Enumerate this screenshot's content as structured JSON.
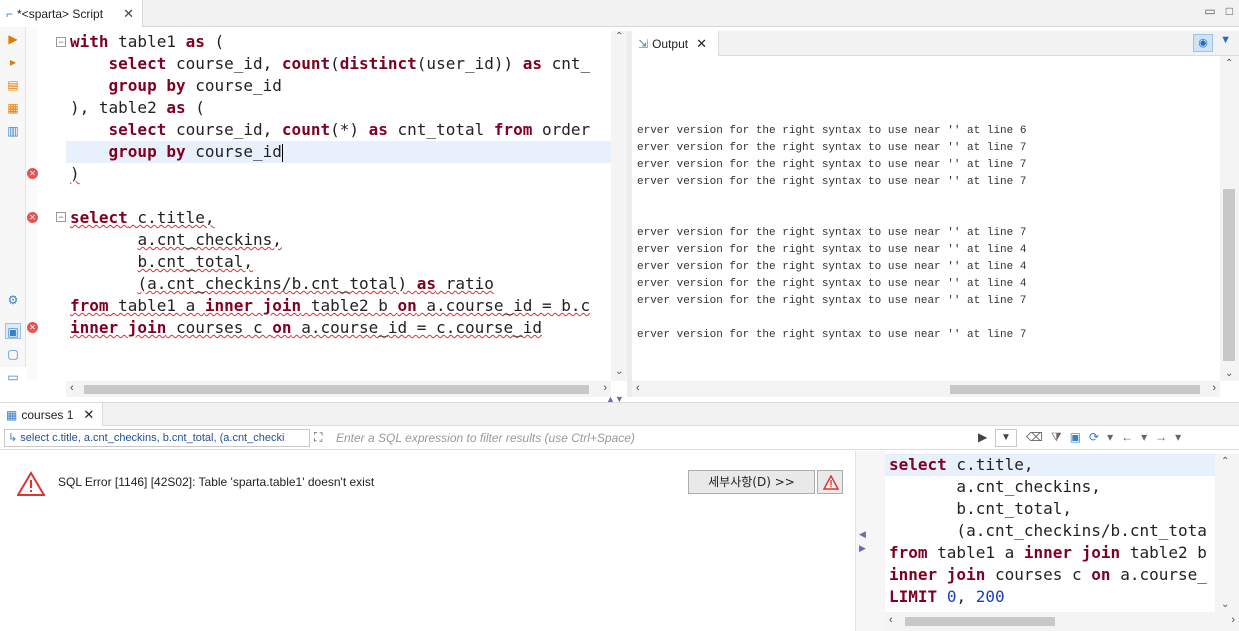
{
  "editor_tab": {
    "title": "*<sparta> Script",
    "close": "✕"
  },
  "window_buttons": {
    "minimize": "▭",
    "maximize": "□"
  },
  "editor_lines": [
    {
      "parts": [
        {
          "t": "with",
          "k": 1,
          "s": 0
        },
        {
          "t": " table1 ",
          "k": 0,
          "s": 0
        },
        {
          "t": "as",
          "k": 1,
          "s": 0
        },
        {
          "t": " (",
          "k": 0,
          "s": 0
        }
      ]
    },
    {
      "parts": [
        {
          "t": "    ",
          "k": 0,
          "s": 0
        },
        {
          "t": "select",
          "k": 1,
          "s": 0
        },
        {
          "t": " course_id, ",
          "k": 0,
          "s": 0
        },
        {
          "t": "count",
          "k": 1,
          "s": 0
        },
        {
          "t": "(",
          "k": 0,
          "s": 0
        },
        {
          "t": "distinct",
          "k": 1,
          "s": 0
        },
        {
          "t": "(user_id)) ",
          "k": 0,
          "s": 0
        },
        {
          "t": "as",
          "k": 1,
          "s": 0
        },
        {
          "t": " cnt_",
          "k": 0,
          "s": 0
        }
      ]
    },
    {
      "parts": [
        {
          "t": "    ",
          "k": 0,
          "s": 0
        },
        {
          "t": "group by",
          "k": 1,
          "s": 0
        },
        {
          "t": " course_id",
          "k": 0,
          "s": 0
        }
      ]
    },
    {
      "parts": [
        {
          "t": "), table2 ",
          "k": 0,
          "s": 0
        },
        {
          "t": "as",
          "k": 1,
          "s": 0
        },
        {
          "t": " (",
          "k": 0,
          "s": 0
        }
      ]
    },
    {
      "parts": [
        {
          "t": "    ",
          "k": 0,
          "s": 0
        },
        {
          "t": "select",
          "k": 1,
          "s": 0
        },
        {
          "t": " course_id, ",
          "k": 0,
          "s": 0
        },
        {
          "t": "count",
          "k": 1,
          "s": 0
        },
        {
          "t": "(*) ",
          "k": 0,
          "s": 0
        },
        {
          "t": "as",
          "k": 1,
          "s": 0
        },
        {
          "t": " cnt_total ",
          "k": 0,
          "s": 0
        },
        {
          "t": "from",
          "k": 1,
          "s": 0
        },
        {
          "t": " order",
          "k": 0,
          "s": 0
        }
      ]
    },
    {
      "parts": [
        {
          "t": "    ",
          "k": 0,
          "s": 0
        },
        {
          "t": "group by",
          "k": 1,
          "s": 0
        },
        {
          "t": " course_id",
          "k": 0,
          "s": 0
        }
      ]
    },
    {
      "parts": [
        {
          "t": ")",
          "k": 0,
          "s": 1
        }
      ]
    },
    {
      "parts": []
    },
    {
      "parts": [
        {
          "t": "select",
          "k": 1,
          "s": 1
        },
        {
          "t": " c.title,",
          "k": 0,
          "s": 1
        }
      ]
    },
    {
      "parts": [
        {
          "t": "       ",
          "k": 0,
          "s": 0
        },
        {
          "t": "a.cnt_checkins,",
          "k": 0,
          "s": 1
        }
      ]
    },
    {
      "parts": [
        {
          "t": "       ",
          "k": 0,
          "s": 0
        },
        {
          "t": "b.cnt_total,",
          "k": 0,
          "s": 1
        }
      ]
    },
    {
      "parts": [
        {
          "t": "       ",
          "k": 0,
          "s": 0
        },
        {
          "t": "(a.cnt_checkins/b.cnt_total) ",
          "k": 0,
          "s": 1
        },
        {
          "t": "as",
          "k": 1,
          "s": 1
        },
        {
          "t": " ratio",
          "k": 0,
          "s": 1
        }
      ]
    },
    {
      "parts": [
        {
          "t": "from",
          "k": 1,
          "s": 1
        },
        {
          "t": " table1 a ",
          "k": 0,
          "s": 1
        },
        {
          "t": "inner join",
          "k": 1,
          "s": 1
        },
        {
          "t": " table2 b ",
          "k": 0,
          "s": 1
        },
        {
          "t": "on",
          "k": 1,
          "s": 1
        },
        {
          "t": " a.course_id = b.c",
          "k": 0,
          "s": 1
        }
      ]
    },
    {
      "parts": [
        {
          "t": "inner join",
          "k": 1,
          "s": 1
        },
        {
          "t": " courses c ",
          "k": 0,
          "s": 1
        },
        {
          "t": "on",
          "k": 1,
          "s": 1
        },
        {
          "t": " a.course_id = c.course_id",
          "k": 0,
          "s": 1
        }
      ]
    }
  ],
  "output_tab": {
    "title": "Output",
    "close": "✕"
  },
  "output_lines": [
    {
      "row": 4,
      "text": "erver version for the right syntax to use near '' at line 6"
    },
    {
      "row": 5,
      "text": "erver version for the right syntax to use near '' at line 7"
    },
    {
      "row": 6,
      "text": "erver version for the right syntax to use near '' at line 7"
    },
    {
      "row": 7,
      "text": "erver version for the right syntax to use near '' at line 7"
    },
    {
      "row": 10,
      "text": "erver version for the right syntax to use near '' at line 7"
    },
    {
      "row": 11,
      "text": "erver version for the right syntax to use near '' at line 4"
    },
    {
      "row": 12,
      "text": "erver version for the right syntax to use near '' at line 4"
    },
    {
      "row": 13,
      "text": "erver version for the right syntax to use near '' at line 4"
    },
    {
      "row": 14,
      "text": "erver version for the right syntax to use near '' at line 7"
    },
    {
      "row": 16,
      "text": "erver version for the right syntax to use near '' at line 7"
    }
  ],
  "results_tab": {
    "title": "courses 1",
    "close": "✕"
  },
  "filter": {
    "query_text": "select c.title, a.cnt_checkins, b.cnt_total, (a.cnt_checki",
    "placeholder": "Enter a SQL expression to filter results (use Ctrl+Space)"
  },
  "error": {
    "message": "SQL Error [1146] [42S02]: Table 'sparta.table1' doesn't exist",
    "details_button": "세부사항(D) >>"
  },
  "sql_preview": [
    {
      "parts": [
        {
          "t": "select",
          "k": 1
        },
        {
          "t": " c.title,",
          "k": 0
        }
      ]
    },
    {
      "parts": [
        {
          "t": "       a.cnt_checkins,",
          "k": 0
        }
      ]
    },
    {
      "parts": [
        {
          "t": "       b.cnt_total,",
          "k": 0
        }
      ]
    },
    {
      "parts": [
        {
          "t": "       (a.cnt_checkins/b.cnt_tota",
          "k": 0
        }
      ]
    },
    {
      "parts": [
        {
          "t": "from",
          "k": 1
        },
        {
          "t": " table1 a ",
          "k": 0
        },
        {
          "t": "inner join",
          "k": 1
        },
        {
          "t": " table2 b",
          "k": 0
        }
      ]
    },
    {
      "parts": [
        {
          "t": "inner join",
          "k": 1
        },
        {
          "t": " courses c ",
          "k": 0
        },
        {
          "t": "on",
          "k": 1
        },
        {
          "t": " a.course_",
          "k": 0
        }
      ]
    },
    {
      "parts": [
        {
          "t": "LIMIT",
          "k": 1
        },
        {
          "t": " ",
          "k": 0
        },
        {
          "t": "0",
          "k": 2
        },
        {
          "t": ", ",
          "k": 0
        },
        {
          "t": "200",
          "k": 2
        }
      ]
    }
  ],
  "colors": {
    "keyword": "#7f0020",
    "number": "#1c3cc0",
    "error": "#e05555",
    "current_line": "#e8f0fb"
  }
}
